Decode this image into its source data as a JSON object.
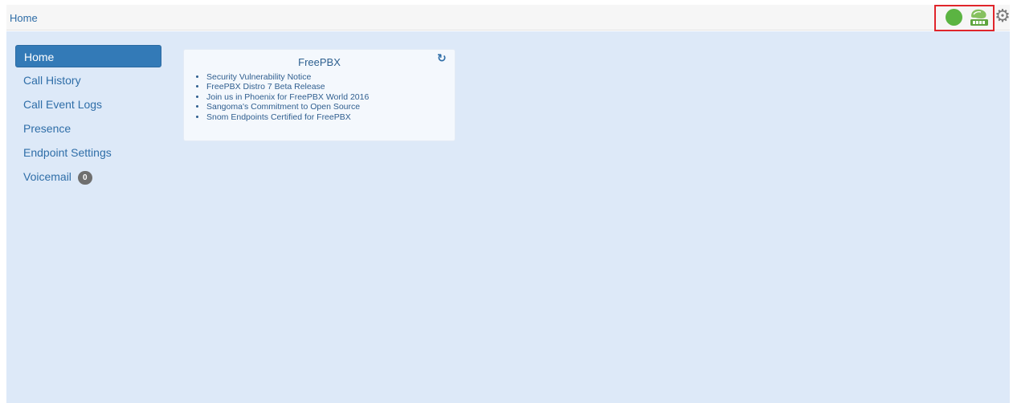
{
  "topbar": {
    "title": "Home",
    "presence_color": "#5bb442",
    "icons": [
      "presence-status-icon",
      "zulu-logo-icon",
      "gear-icon"
    ]
  },
  "sidebar": {
    "items": [
      {
        "label": "Home",
        "active": true
      },
      {
        "label": "Call History"
      },
      {
        "label": "Call Event Logs"
      },
      {
        "label": "Presence"
      },
      {
        "label": "Endpoint Settings"
      },
      {
        "label": "Voicemail",
        "badge": "0"
      }
    ]
  },
  "widget": {
    "title": "FreePBX",
    "items": [
      "Security Vulnerability Notice",
      "FreePBX Distro 7 Beta Release",
      "Join us in Phoenix for FreePBX World 2016",
      "Sangoma's Commitment to Open Source",
      "Snom Endpoints Certified for FreePBX"
    ]
  },
  "colors": {
    "accent": "#337ab7",
    "background": "#dde9f8",
    "highlight_border": "#e0252b"
  }
}
